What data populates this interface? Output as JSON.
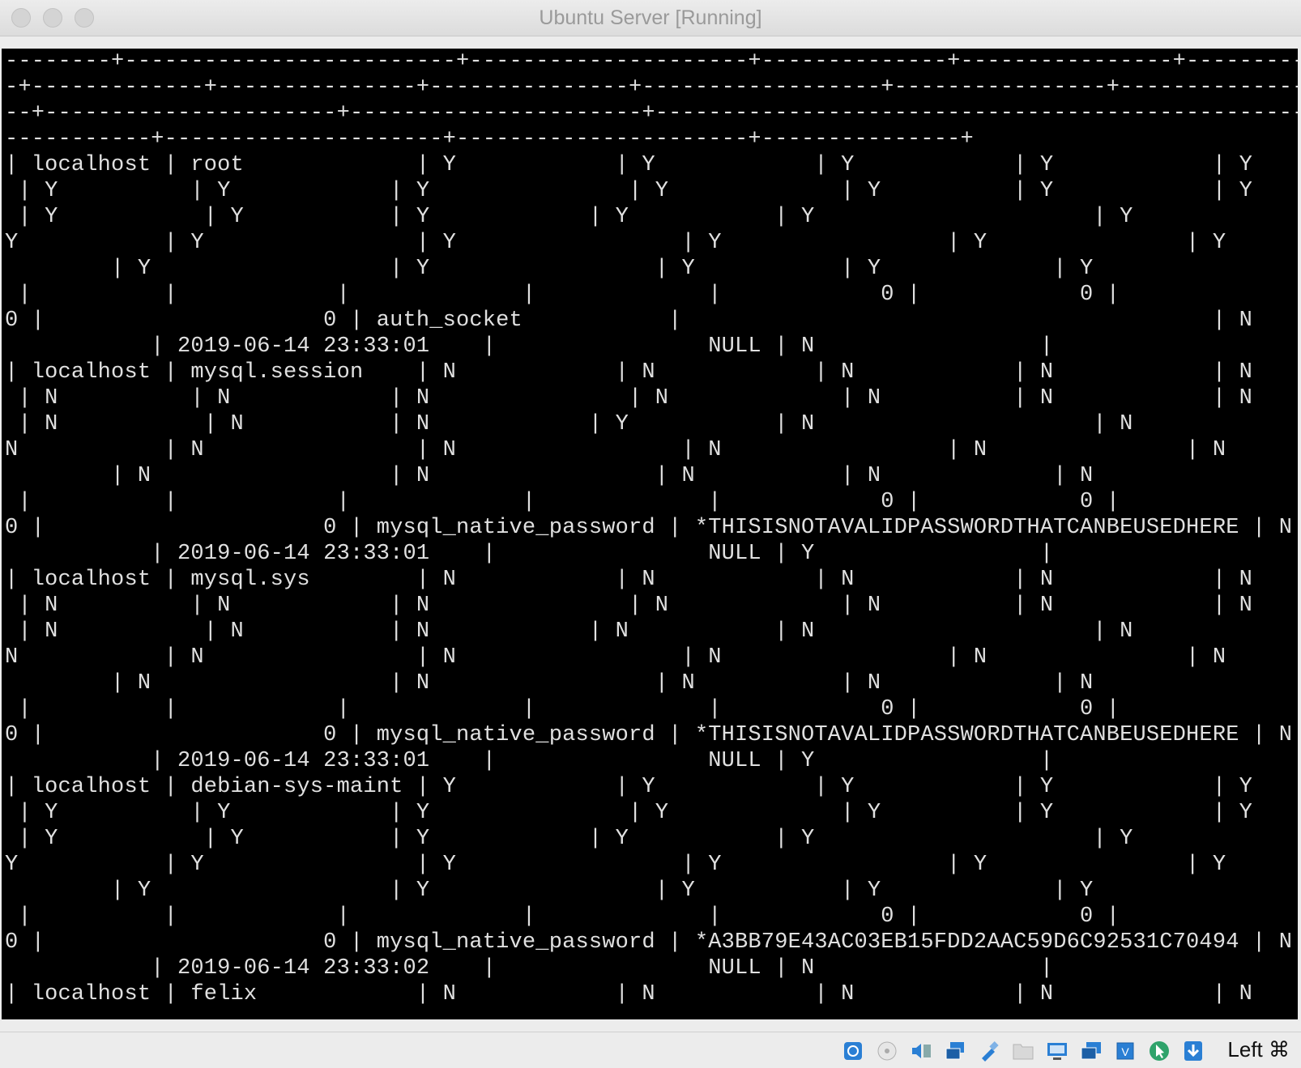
{
  "window": {
    "title": "Ubuntu Server [Running]"
  },
  "terminal": {
    "lines": [
      "--------+-------------------------+---------------------+--------------+----------------+-------------------------",
      "-+-------------+---------------+---------------+------------------+----------------+---------------+-------------",
      "--+----------------------+----------------------+---------------------------------------------------------+------",
      "-----------+---------------------+----------------------+---------------+",
      "| localhost | root             | Y            | Y            | Y            | Y            | Y",
      " | Y          | Y            | Y               | Y             | Y          | Y            | Y",
      " | Y           | Y           | Y            | Y           | Y                     | Y                   |",
      "Y           | Y                | Y                 | Y                 | Y               | Y",
      "        | Y                  | Y                 | Y           | Y             | Y",
      " |          |            |             |             |            0 |            0 |",
      "0 |                     0 | auth_socket           |                                        | N",
      "           | 2019-06-14 23:33:01    |                NULL | N                 |",
      "| localhost | mysql.session    | N            | N            | N            | N            | N",
      " | N          | N            | N               | N             | N          | N            | N",
      " | N           | N           | N            | Y           | N                     | N                   |",
      "N           | N                | N                 | N                 | N               | N",
      "        | N                  | N                 | N           | N             | N",
      " |          |            |             |             |            0 |            0 |",
      "0 |                     0 | mysql_native_password | *THISISNOTAVALIDPASSWORDTHATCANBEUSEDHERE | N",
      "           | 2019-06-14 23:33:01    |                NULL | Y                 |",
      "| localhost | mysql.sys        | N            | N            | N            | N            | N",
      " | N          | N            | N               | N             | N          | N            | N",
      " | N           | N           | N            | N           | N                     | N                   |",
      "N           | N                | N                 | N                 | N               | N",
      "        | N                  | N                 | N           | N             | N",
      " |          |            |             |             |            0 |            0 |",
      "0 |                     0 | mysql_native_password | *THISISNOTAVALIDPASSWORDTHATCANBEUSEDHERE | N",
      "           | 2019-06-14 23:33:01    |                NULL | Y                 |",
      "| localhost | debian-sys-maint | Y            | Y            | Y            | Y            | Y",
      " | Y          | Y            | Y               | Y             | Y          | Y            | Y",
      " | Y           | Y           | Y            | Y           | Y                     | Y                   |",
      "Y           | Y                | Y                 | Y                 | Y               | Y",
      "        | Y                  | Y                 | Y           | Y             | Y",
      " |          |            |             |             |            0 |            0 |",
      "0 |                     0 | mysql_native_password | *A3BB79E43AC03EB15FDD2AAC59D6C92531C70494 | N",
      "           | 2019-06-14 23:33:02    |                NULL | N                 |",
      "| localhost | felix            | N            | N            | N            | N            | N"
    ]
  },
  "statusbar": {
    "icons": [
      "hard-disk-icon",
      "optical-drive-icon",
      "audio-icon",
      "network-icon",
      "usb-icon",
      "shared-folder-icon",
      "display-icon",
      "screen-recording-icon",
      "cpu-vt-icon",
      "mouse-integration-icon",
      "keyboard-capture-icon"
    ],
    "host_key": "Left ⌘"
  }
}
